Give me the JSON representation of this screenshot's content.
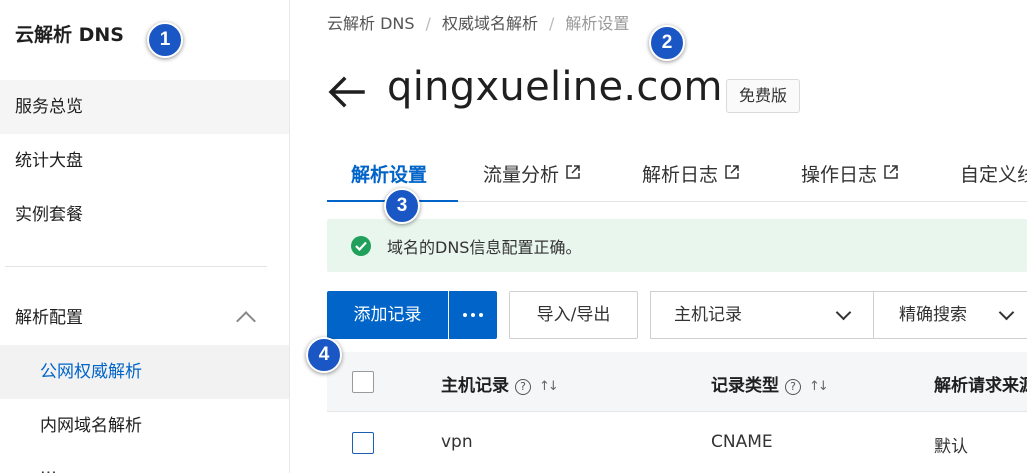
{
  "sidebar": {
    "title": "云解析 DNS",
    "items": [
      {
        "label": "服务总览"
      },
      {
        "label": "统计大盘"
      },
      {
        "label": "实例套餐"
      },
      {
        "label": "解析配置"
      },
      {
        "label": "公网权威解析"
      },
      {
        "label": "内网域名解析"
      }
    ]
  },
  "breadcrumb": [
    "云解析 DNS",
    "权威域名解析",
    "解析设置"
  ],
  "header": {
    "domain": "qingxueline.com",
    "edition": "免费版"
  },
  "tabs": [
    {
      "label": "解析设置"
    },
    {
      "label": "流量分析"
    },
    {
      "label": "解析日志"
    },
    {
      "label": "操作日志"
    },
    {
      "label": "自定义线"
    }
  ],
  "alert": {
    "text": "域名的DNS信息配置正确。",
    "color": "#21a05b"
  },
  "toolbar": {
    "add_record": "添加记录",
    "import_export": "导入/导出",
    "filter_select": "主机记录",
    "search_mode": "精确搜索"
  },
  "table": {
    "columns": [
      "主机记录",
      "记录类型",
      "解析请求来源"
    ],
    "rows": [
      {
        "host": "vpn",
        "type": "CNAME",
        "line": "默认"
      }
    ]
  },
  "markers": [
    "1",
    "2",
    "3",
    "4"
  ],
  "colors": {
    "accent": "#0064c8",
    "marker": "#1a56c4"
  }
}
